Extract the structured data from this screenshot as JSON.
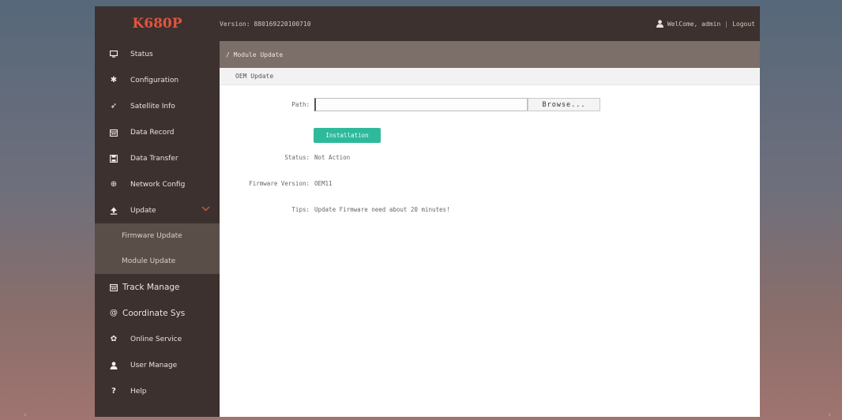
{
  "brand": "K680P",
  "version_text": "Version: 880169220100710",
  "welcome_text": "WelCome, admin",
  "separator": "|",
  "logout_label": "Logout",
  "sidebar": {
    "items": [
      {
        "label": "Status",
        "icon": "monitor-icon"
      },
      {
        "label": "Configuration",
        "icon": "tools-icon"
      },
      {
        "label": "Satellite Info",
        "icon": "satellite-icon"
      },
      {
        "label": "Data Record",
        "icon": "calendar-icon"
      },
      {
        "label": "Data Transfer",
        "icon": "save-icon"
      },
      {
        "label": "Network Config",
        "icon": "network-icon"
      },
      {
        "label": "Update",
        "icon": "upload-icon",
        "expanded": true
      }
    ],
    "sub_items": [
      {
        "label": "Firmware Update"
      },
      {
        "label": "Module Update"
      }
    ],
    "items_after": [
      {
        "label": "Track Manage",
        "icon": "calendar-icon"
      },
      {
        "label": "Coordinate Sys",
        "icon": "at-icon"
      },
      {
        "label": "Online Service",
        "icon": "service-icon"
      },
      {
        "label": "User Manage",
        "icon": "user-icon"
      },
      {
        "label": "Help",
        "icon": "question-icon"
      }
    ]
  },
  "breadcrumb": "/ Module Update",
  "section_title": "OEM Update",
  "form": {
    "path_label": "Path:",
    "path_value": "",
    "browse_label": "Browse...",
    "install_label": "Installation",
    "status_label": "Status:",
    "status_value": "Not Action",
    "fw_label": "Firmware Version:",
    "fw_value": "OEM11",
    "tips_label": "Tips:",
    "tips_value": "Update Firmware need about 20 minutes!"
  },
  "colors": {
    "sidebar_bg": "#3c312e",
    "brand": "#e0553f",
    "breadcrumb_bg": "#7c6e69",
    "install_button": "#2fb99b"
  }
}
